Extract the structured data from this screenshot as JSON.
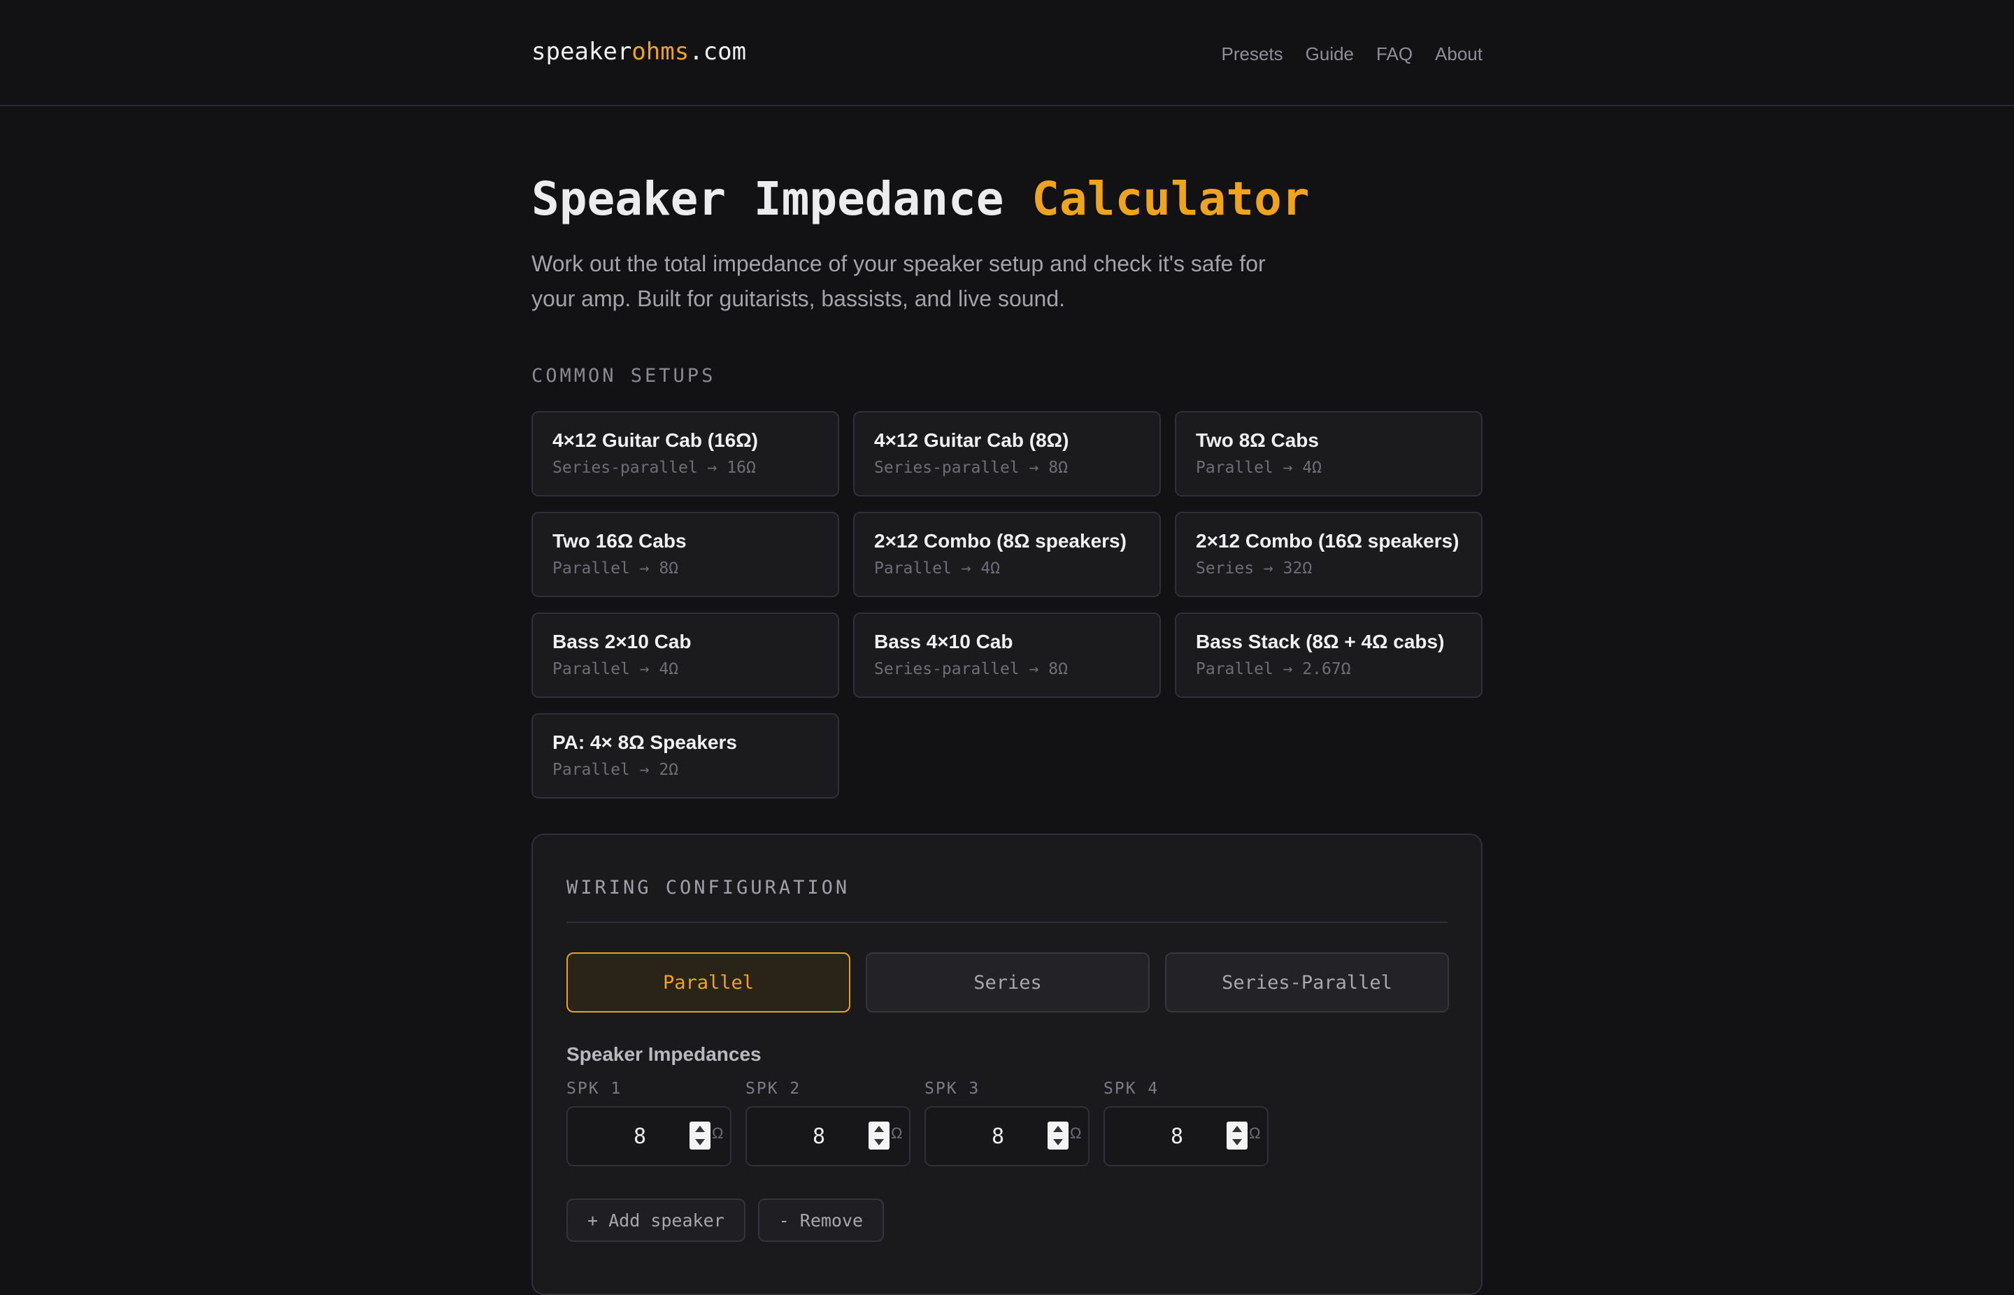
{
  "header": {
    "logo": {
      "part1": "speaker",
      "part2": "ohms",
      "part3": ".com"
    },
    "nav": [
      "Presets",
      "Guide",
      "FAQ",
      "About"
    ]
  },
  "hero": {
    "title_main": "Speaker Impedance",
    "title_accent": "Calculator",
    "subtitle": "Work out the total impedance of your speaker setup and check it's safe for your amp. Built for guitarists, bassists, and live sound."
  },
  "presets": {
    "label": "COMMON SETUPS",
    "items": [
      {
        "name": "4×12 Guitar Cab (16Ω)",
        "desc": "Series-parallel → 16Ω"
      },
      {
        "name": "4×12 Guitar Cab (8Ω)",
        "desc": "Series-parallel → 8Ω"
      },
      {
        "name": "Two 8Ω Cabs",
        "desc": "Parallel → 4Ω"
      },
      {
        "name": "Two 16Ω Cabs",
        "desc": "Parallel → 8Ω"
      },
      {
        "name": "2×12 Combo (8Ω speakers)",
        "desc": "Parallel → 4Ω"
      },
      {
        "name": "2×12 Combo (16Ω speakers)",
        "desc": "Series → 32Ω"
      },
      {
        "name": "Bass 2×10 Cab",
        "desc": "Parallel → 4Ω"
      },
      {
        "name": "Bass 4×10 Cab",
        "desc": "Series-parallel → 8Ω"
      },
      {
        "name": "Bass Stack (8Ω + 4Ω cabs)",
        "desc": "Parallel → 2.67Ω"
      },
      {
        "name": "PA: 4× 8Ω Speakers",
        "desc": "Parallel → 2Ω"
      }
    ]
  },
  "wiring": {
    "label": "WIRING CONFIGURATION",
    "modes": [
      "Parallel",
      "Series",
      "Series-Parallel"
    ],
    "active_mode": "Parallel",
    "impedance_label": "Speaker Impedances",
    "unit": "Ω",
    "speakers": [
      {
        "label": "SPK 1",
        "value": "8"
      },
      {
        "label": "SPK 2",
        "value": "8"
      },
      {
        "label": "SPK 3",
        "value": "8"
      },
      {
        "label": "SPK 4",
        "value": "8"
      }
    ],
    "add_label": "+ Add speaker",
    "remove_label": "- Remove"
  },
  "colors": {
    "accent": "#f0a41e",
    "background": "#121214",
    "card": "#1b1b1e"
  }
}
